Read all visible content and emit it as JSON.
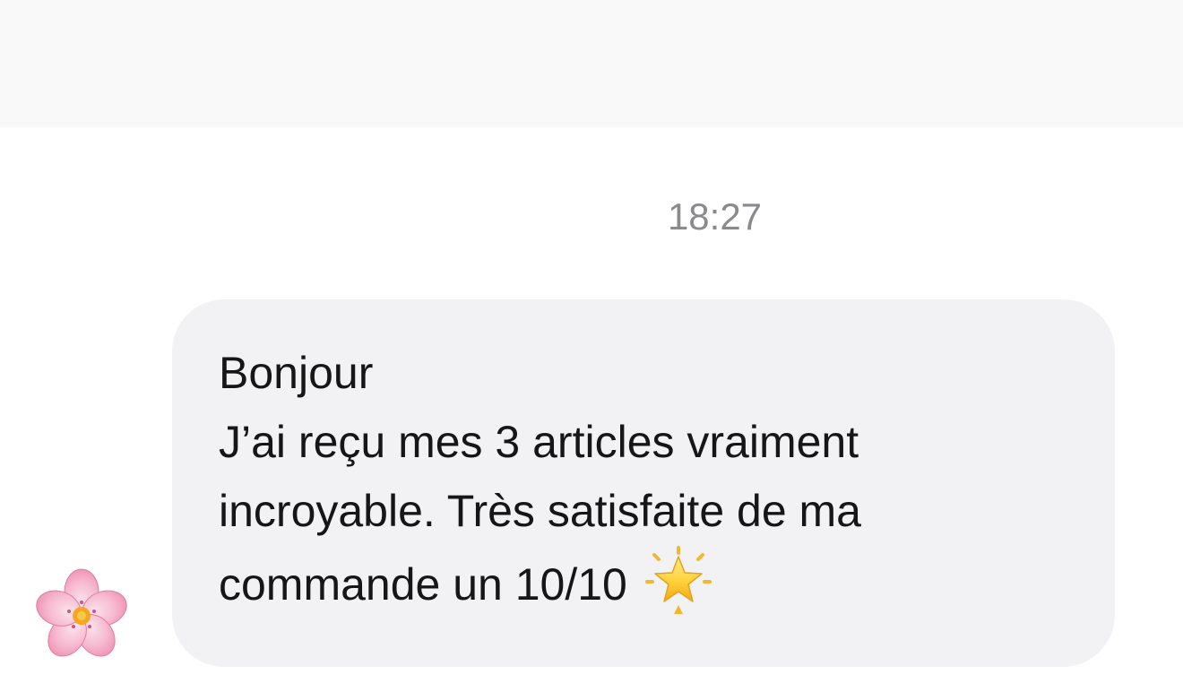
{
  "conversation": {
    "timestamp": "18:27",
    "message": {
      "greeting": "Bonjour",
      "body": "J’ai reçu mes 3 articles vraiment\nincroyable. Très satisfaite de ma\ncommande un 10/10",
      "emoji": "glowing-star-icon"
    },
    "sender_avatar": "cherry-blossom-icon"
  },
  "colors": {
    "header_background": "#f9f9fa",
    "bubble_background": "#f2f2f5",
    "timestamp_text": "#8a8a8e",
    "message_text": "#161616"
  }
}
